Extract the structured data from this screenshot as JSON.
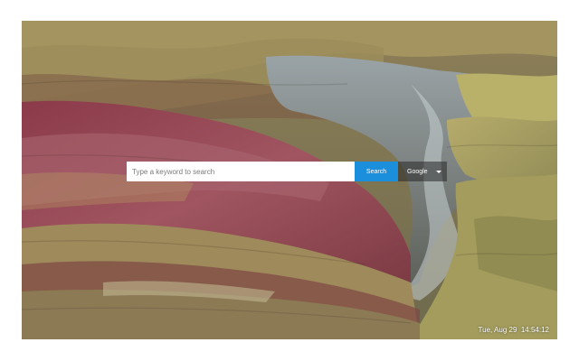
{
  "background": {
    "image": "painted-hills-landscape"
  },
  "search": {
    "placeholder": "Type a keyword to search",
    "value": "",
    "button_label": "Search",
    "engine_selected": "Google",
    "button_color": "#1b8fdc",
    "engine_icon": "chevron-down-icon"
  },
  "clock": {
    "day": "Tue,",
    "date": "Aug 29",
    "time": "14:54:12"
  }
}
